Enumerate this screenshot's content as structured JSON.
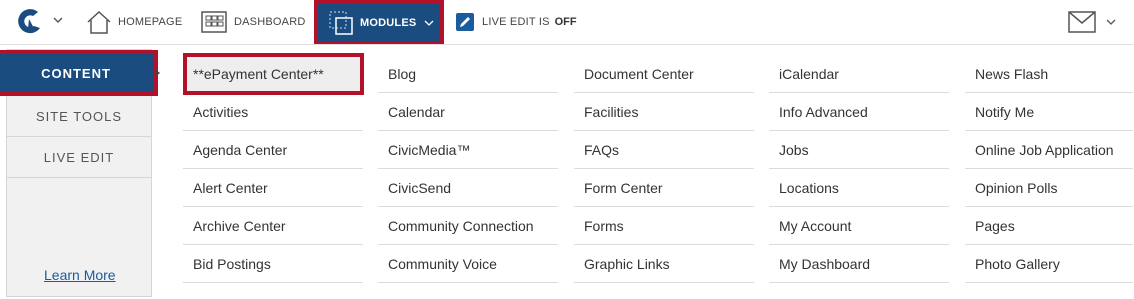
{
  "topbar": {
    "home_label": "HOMEPAGE",
    "dashboard_label": "DASHBOARD",
    "modules_label": "MODULES",
    "live_edit_label": "LIVE EDIT IS",
    "live_edit_state": "OFF"
  },
  "sidebar": {
    "tabs": [
      {
        "label": "CONTENT",
        "active": true
      },
      {
        "label": "SITE TOOLS"
      },
      {
        "label": "LIVE EDIT"
      }
    ],
    "learn_more": "Learn More"
  },
  "modules": {
    "columns": [
      [
        "**ePayment Center**",
        "Activities",
        "Agenda Center",
        "Alert Center",
        "Archive Center",
        "Bid Postings"
      ],
      [
        "Blog",
        "Calendar",
        "CivicMedia™",
        "CivicSend",
        "Community Connection",
        "Community Voice"
      ],
      [
        "Document Center",
        "Facilities",
        "FAQs",
        "Form Center",
        "Forms",
        "Graphic Links"
      ],
      [
        "iCalendar",
        "Info Advanced",
        "Jobs",
        "Locations",
        "My Account",
        "My Dashboard"
      ],
      [
        "News Flash",
        "Notify Me",
        "Online Job Application",
        "Opinion Polls",
        "Pages",
        "Photo Gallery"
      ]
    ]
  },
  "colors": {
    "accent_blue": "#1a4c80",
    "highlight_red": "#b3102a",
    "link_blue": "#1a5c9e"
  },
  "icons": [
    "logo-icon",
    "home-icon",
    "dashboard-icon",
    "modules-icon",
    "live-edit-icon",
    "mail-icon",
    "chevron-down-icon"
  ]
}
